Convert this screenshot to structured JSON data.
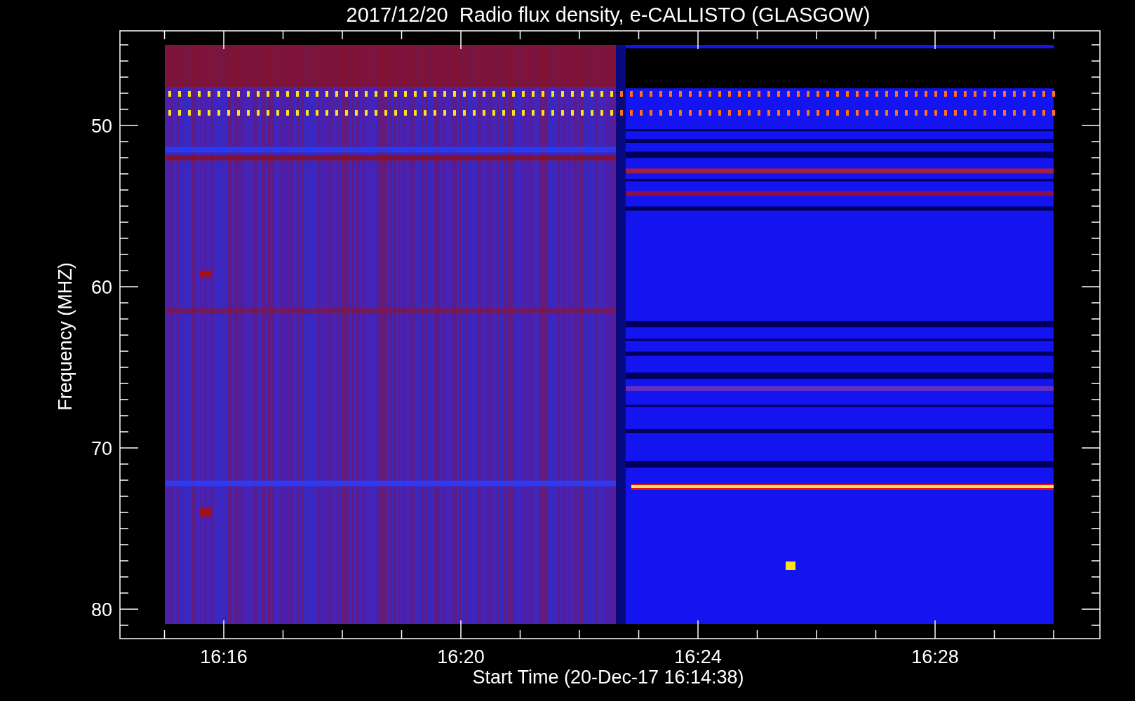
{
  "title": "2017/12/20  Radio flux density, e-CALLISTO (GLASGOW)",
  "y_axis": {
    "label": "Frequency (MHZ)",
    "tick_labels": [
      "50",
      "60",
      "70",
      "80"
    ]
  },
  "x_axis": {
    "label": "Start Time (20-Dec-17 16:14:38)",
    "tick_labels": [
      "16:16",
      "16:20",
      "16:24",
      "16:28"
    ]
  }
}
